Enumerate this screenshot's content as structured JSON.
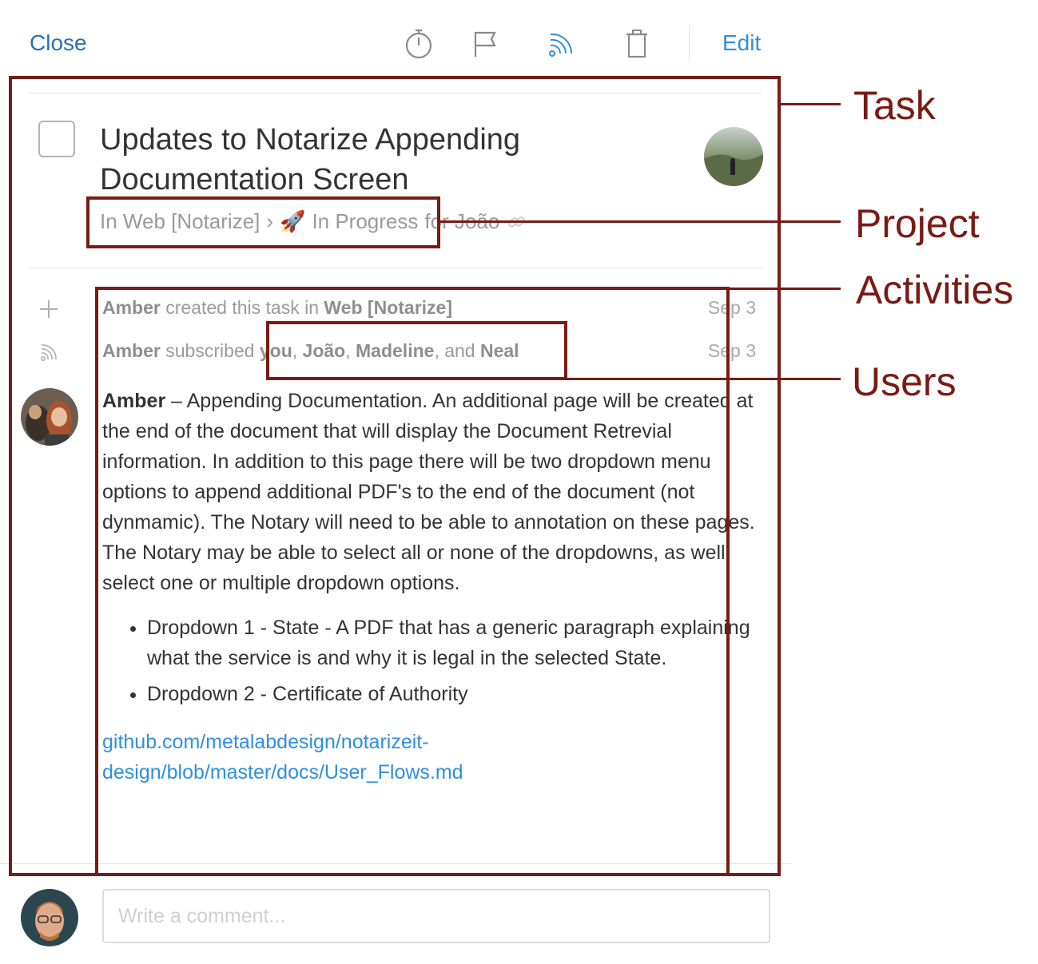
{
  "toolbar": {
    "close_label": "Close",
    "edit_label": "Edit",
    "icons": [
      "timer-icon",
      "flag-icon",
      "subscribe-icon",
      "trash-icon"
    ],
    "accent_color": "#2f8fe0"
  },
  "task": {
    "title": "Updates to Notarize Appending Documentation Screen",
    "project": "In Web [Notarize]",
    "separator": "›",
    "status_emoji": "🚀",
    "status": "In Progress",
    "for_user": "for João"
  },
  "activities": [
    {
      "icon": "plus-icon",
      "actor": "Amber",
      "text": " created this task in ",
      "target": "Web [Notarize]",
      "date": "Sep 3"
    },
    {
      "icon": "subscribe-icon",
      "actor": "Amber",
      "text": " subscribed ",
      "users": [
        "you",
        "João",
        "Madeline",
        "Neal"
      ],
      "date": "Sep 3"
    }
  ],
  "comment": {
    "author": "Amber",
    "dash": " – ",
    "body": "Appending Documentation. An additional page will be created at the end of the document that will display the Document Retrevial information. In addition to this page there will be two dropdown menu options to append additional PDF's to the end of the document (not dynmamic). The Notary will need to be able to annotation on these pages. The Notary may be able to select all or none of the dropdowns, as well, select one or multiple dropdown options.",
    "bullets": [
      "Dropdown 1 - State - A PDF that has a generic paragraph explaining what the service is and why it is legal in the selected State.",
      "Dropdown 2 - Certificate of Authority"
    ],
    "link": "github.com/metalabdesign/notarizeit-design/blob/master/docs/User_Flows.md"
  },
  "composer": {
    "placeholder": "Write a comment..."
  },
  "annotations": {
    "task": "Task",
    "project": "Project",
    "activities": "Activities",
    "users": "Users",
    "color": "#7a1a14"
  },
  "labels": {
    "comma": ", ",
    "and": ", and "
  }
}
